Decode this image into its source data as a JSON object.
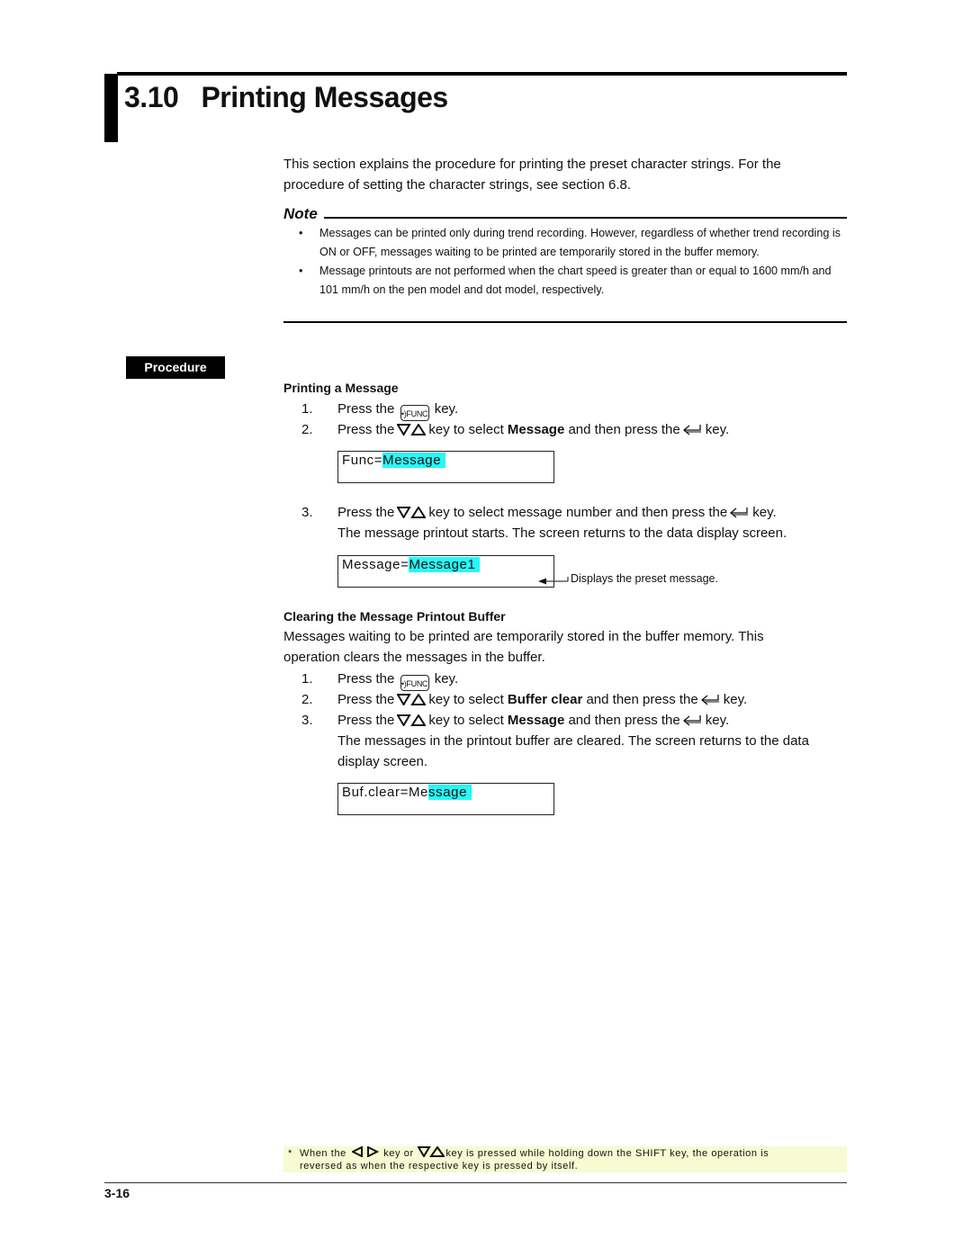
{
  "section": {
    "number": "3.10",
    "title": "Printing Messages"
  },
  "intro": "This section explains the procedure for printing the preset character strings.  For the procedure of setting the character strings, see section 6.8.",
  "note": {
    "heading": "Note",
    "bullet_glyph": "•",
    "items": [
      "Messages can be printed only during trend recording.  However, regardless of whether trend recording is ON or OFF, messages waiting to be printed are temporarily stored in the buffer memory.",
      "Message printouts are not performed when the chart speed is greater than or equal to 1600 mm/h and 101 mm/h on the pen model and dot model, respectively."
    ]
  },
  "procedure_tag": "Procedure",
  "keys": {
    "func_label": "FUNC"
  },
  "printing": {
    "heading": "Printing a Message",
    "steps": [
      {
        "num": "1.",
        "pre": "Press the",
        "key": "func",
        "post": "key."
      },
      {
        "num": "2.",
        "pre": "Press the",
        "key": "updown",
        "mid": "key to select",
        "bold": "Message",
        "mid2": "and then press the",
        "key2": "enter",
        "post": "key."
      },
      {
        "num": "3.",
        "pre": "Press the",
        "key": "updown",
        "mid": "key to select message number and then press the",
        "key2": "enter",
        "post": "key."
      }
    ],
    "step3_result": "The message printout starts.  The screen returns to the data display screen.",
    "lcd1": {
      "prefix": "Func=",
      "highlight": "Message",
      "pad": " "
    },
    "lcd2": {
      "prefix": "Message=",
      "highlight": "Message1",
      "pad": " "
    },
    "lcd2_annotation": "Displays the preset message."
  },
  "clearing": {
    "heading": "Clearing the Message Printout Buffer",
    "description": "Messages waiting to be printed are temporarily stored in the buffer memory.  This operation clears the messages in the buffer.",
    "steps": [
      {
        "num": "1.",
        "pre": "Press the",
        "post": "key."
      },
      {
        "num": "2.",
        "pre": "Press the",
        "mid": "key to select",
        "bold": "Buffer clear",
        "mid2": "and then press the",
        "post": "key."
      },
      {
        "num": "3.",
        "pre": "Press the",
        "mid": "key to select",
        "bold": "Message",
        "mid2": "and then press the",
        "post": "key."
      }
    ],
    "step3_result": "The messages in the printout buffer are cleared.  The screen returns to the data display screen.",
    "lcd": {
      "prefix": "Buf.clear=Me",
      "highlight": "ssage",
      "pad": " "
    }
  },
  "footnote": {
    "marker": "*",
    "line1_a": "When the",
    "line1_b": "key or",
    "line1_c": "key is pressed while holding down the SHIFT key, the operation is",
    "line2": "reversed as when the respective key is pressed by itself."
  },
  "page_number": "3-16"
}
